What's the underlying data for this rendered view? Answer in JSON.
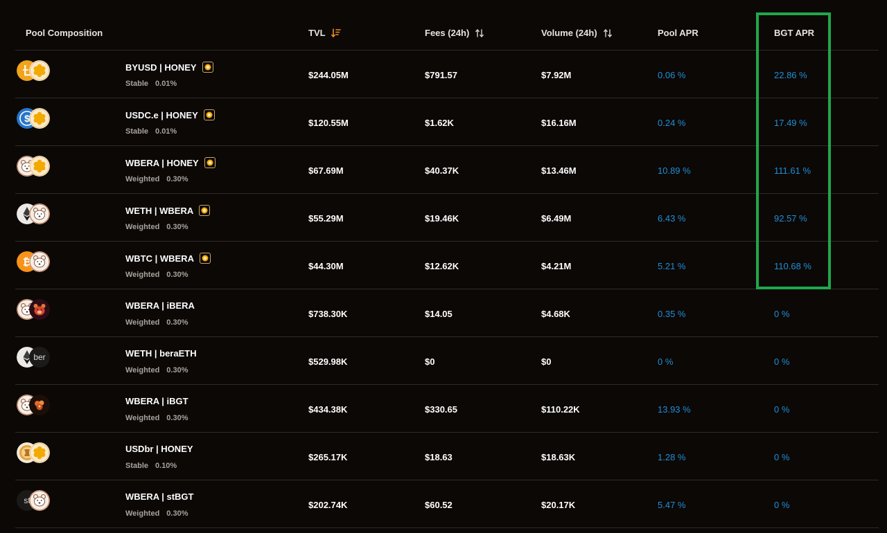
{
  "headers": {
    "pool_composition": "Pool Composition",
    "tvl": "TVL",
    "fees": "Fees (24h)",
    "volume": "Volume (24h)",
    "pool_apr": "Pool APR",
    "bgt_apr": "BGT APR"
  },
  "colors": {
    "accent_blue": "#1e8fd6",
    "highlight_green": "#1fa84a",
    "sort_active": "#f08a24",
    "background": "#0c0806"
  },
  "rows": [
    {
      "name": "BYUSD | HONEY",
      "type": "Stable",
      "fee": "0.01%",
      "tvl": "$244.05M",
      "fees": "$791.57",
      "volume": "$7.92M",
      "pool_apr": "0.06 %",
      "bgt_apr": "22.86 %",
      "bgt_badge": true,
      "icons": [
        "byusd-icon",
        "honey-icon"
      ]
    },
    {
      "name": "USDC.e | HONEY",
      "type": "Stable",
      "fee": "0.01%",
      "tvl": "$120.55M",
      "fees": "$1.62K",
      "volume": "$16.16M",
      "pool_apr": "0.24 %",
      "bgt_apr": "17.49 %",
      "bgt_badge": true,
      "icons": [
        "usdc-icon",
        "honey-icon"
      ]
    },
    {
      "name": "WBERA | HONEY",
      "type": "Weighted",
      "fee": "0.30%",
      "tvl": "$67.69M",
      "fees": "$40.37K",
      "volume": "$13.46M",
      "pool_apr": "10.89 %",
      "bgt_apr": "111.61 %",
      "bgt_badge": true,
      "icons": [
        "wbera-icon",
        "honey-icon"
      ]
    },
    {
      "name": "WETH | WBERA",
      "type": "Weighted",
      "fee": "0.30%",
      "tvl": "$55.29M",
      "fees": "$19.46K",
      "volume": "$6.49M",
      "pool_apr": "6.43 %",
      "bgt_apr": "92.57 %",
      "bgt_badge": true,
      "icons": [
        "weth-icon",
        "wbera-icon"
      ]
    },
    {
      "name": "WBTC | WBERA",
      "type": "Weighted",
      "fee": "0.30%",
      "tvl": "$44.30M",
      "fees": "$12.62K",
      "volume": "$4.21M",
      "pool_apr": "5.21 %",
      "bgt_apr": "110.68 %",
      "bgt_badge": true,
      "icons": [
        "wbtc-icon",
        "wbera-icon"
      ]
    },
    {
      "name": "WBERA | iBERA",
      "type": "Weighted",
      "fee": "0.30%",
      "tvl": "$738.30K",
      "fees": "$14.05",
      "volume": "$4.68K",
      "pool_apr": "0.35 %",
      "bgt_apr": "0 %",
      "bgt_badge": false,
      "icons": [
        "wbera-icon",
        "ibera-icon"
      ]
    },
    {
      "name": "WETH | beraETH",
      "type": "Weighted",
      "fee": "0.30%",
      "tvl": "$529.98K",
      "fees": "$0",
      "volume": "$0",
      "pool_apr": "0 %",
      "bgt_apr": "0 %",
      "bgt_badge": false,
      "icons": [
        "weth-icon",
        "beraeth-icon"
      ],
      "icon_text_b": "ber"
    },
    {
      "name": "WBERA | iBGT",
      "type": "Weighted",
      "fee": "0.30%",
      "tvl": "$434.38K",
      "fees": "$330.65",
      "volume": "$110.22K",
      "pool_apr": "13.93 %",
      "bgt_apr": "0 %",
      "bgt_badge": false,
      "icons": [
        "wbera-icon",
        "ibgt-icon"
      ]
    },
    {
      "name": "USDbr | HONEY",
      "type": "Stable",
      "fee": "0.10%",
      "tvl": "$265.17K",
      "fees": "$18.63",
      "volume": "$18.63K",
      "pool_apr": "1.28 %",
      "bgt_apr": "0 %",
      "bgt_badge": false,
      "icons": [
        "usdbr-icon",
        "honey-icon"
      ]
    },
    {
      "name": "WBERA | stBGT",
      "type": "Weighted",
      "fee": "0.30%",
      "tvl": "$202.74K",
      "fees": "$60.52",
      "volume": "$20.17K",
      "pool_apr": "5.47 %",
      "bgt_apr": "0 %",
      "bgt_badge": false,
      "icons": [
        "stbgt-icon",
        "wbera-icon"
      ],
      "icon_text_a": "st"
    }
  ]
}
